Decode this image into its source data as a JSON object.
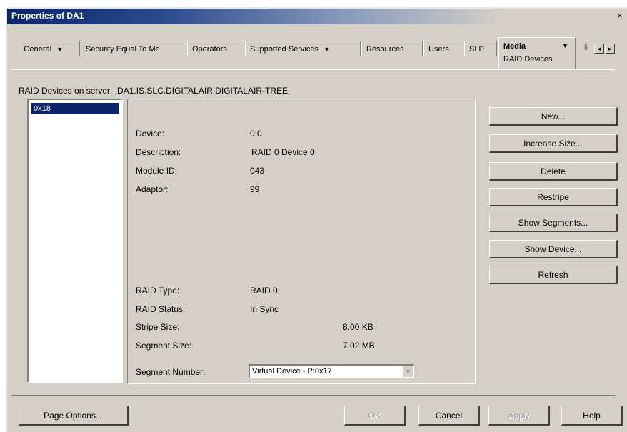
{
  "window": {
    "title": "Properties of DA1",
    "close_glyph": "×"
  },
  "tabs": [
    {
      "label": "General"
    },
    {
      "label": "Security Equal To Me"
    },
    {
      "label": "Operators"
    },
    {
      "label": "Supported Services"
    },
    {
      "label": "Resources"
    },
    {
      "label": "Users"
    },
    {
      "label": "SLP"
    }
  ],
  "active_tab": {
    "label": "Media",
    "sublabel": "RAID Devices",
    "dropdown_glyph": "▼"
  },
  "tab_overflow": {
    "label": "li",
    "left_glyph": "◄",
    "right_glyph": "►"
  },
  "header": "RAID Devices on server: .DA1.IS.SLC.DIGITALAIR.DIGITALAIR-TREE.",
  "device_list": {
    "items": [
      "0x18"
    ],
    "selected": "0x18"
  },
  "details": {
    "device_label": "Device:",
    "device_value": "0:0",
    "description_label": "Description:",
    "description_value": "RAID 0 Device 0",
    "module_label": "Module ID:",
    "module_value": "043",
    "adaptor_label": "Adaptor:",
    "adaptor_value": "99",
    "raid_type_label": "RAID Type:",
    "raid_type_value": "RAID 0",
    "raid_status_label": "RAID Status:",
    "raid_status_value": "In Sync",
    "stripe_label": "Stripe Size:",
    "stripe_value": "8.00 KB",
    "segment_size_label": "Segment Size:",
    "segment_size_value": "7.02 MB",
    "segment_number_label": "Segment Number:",
    "segment_number_value": "Virtual Device - P:0x17"
  },
  "side_buttons": {
    "new": "New...",
    "increase": "Increase Size...",
    "delete": "Delete",
    "restripe": "Restripe",
    "show_segments": "Show Segments...",
    "show_device": "Show Device...",
    "refresh": "Refresh"
  },
  "footer": {
    "page_options": "Page Options...",
    "ok": "OK",
    "cancel": "Cancel",
    "apply": "Apply",
    "help": "Help"
  }
}
